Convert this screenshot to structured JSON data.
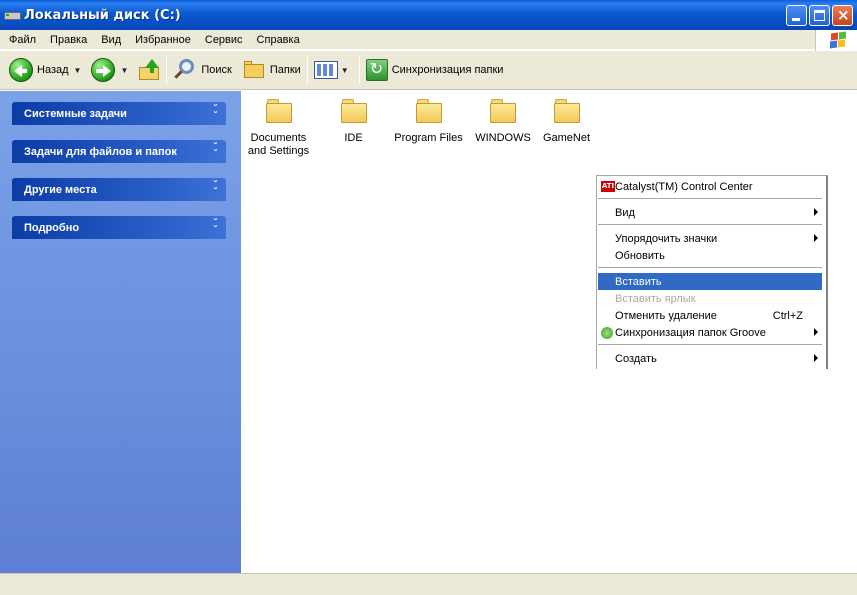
{
  "window": {
    "title": "Локальный диск (C:)"
  },
  "menu": [
    "Файл",
    "Правка",
    "Вид",
    "Избранное",
    "Сервис",
    "Справка"
  ],
  "toolbar": {
    "back": "Назад",
    "search": "Поиск",
    "folders": "Папки",
    "sync": "Синхронизация папки"
  },
  "taskpane": [
    {
      "label": "Системные задачи"
    },
    {
      "label": "Задачи для файлов и папок"
    },
    {
      "label": "Другие места"
    },
    {
      "label": "Подробно"
    }
  ],
  "items": [
    {
      "line1": "Documents",
      "line2": "and Settings"
    },
    {
      "line1": "IDE",
      "line2": ""
    },
    {
      "line1": "Program Files",
      "line2": ""
    },
    {
      "line1": "WINDOWS",
      "line2": ""
    },
    {
      "line1": "GameNet",
      "line2": ""
    }
  ],
  "context_menu": {
    "catalyst": "Catalyst(TM) Control Center",
    "view": "Вид",
    "arrange": "Упорядочить значки",
    "refresh": "Обновить",
    "paste": "Вставить",
    "paste_shortcut": "Вставить ярлык",
    "undo": "Отменить удаление",
    "undo_shortcut": "Ctrl+Z",
    "groove": "Синхронизация папок Groove",
    "new": "Создать"
  },
  "colors": {
    "titlebar": "#0a58d0",
    "highlight": "#316ac5",
    "taskpane": "#6d91e0",
    "chrome": "#ece9d8"
  }
}
